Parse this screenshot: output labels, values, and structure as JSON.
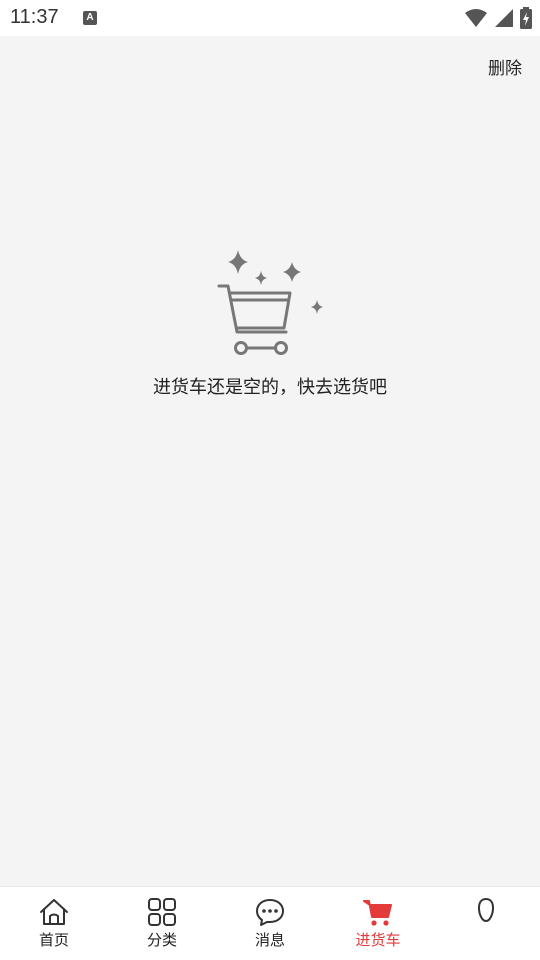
{
  "status_bar": {
    "time": "11:37",
    "icons": [
      "a-notification-icon",
      "wifi-icon",
      "signal-icon",
      "battery-charging-icon"
    ]
  },
  "header": {
    "delete_label": "删除"
  },
  "empty_state": {
    "illustration": "empty-cart-sparkles-icon",
    "message": "进货车还是空的，快去选货吧"
  },
  "tab_bar": {
    "active_color": "#e33a3a",
    "tabs": [
      {
        "label": "首页",
        "icon": "home-icon",
        "active": false
      },
      {
        "label": "分类",
        "icon": "grid-icon",
        "active": false
      },
      {
        "label": "消息",
        "icon": "chat-bubble-icon",
        "active": false
      },
      {
        "label": "进货车",
        "icon": "cart-icon",
        "active": true
      },
      {
        "label": "",
        "icon": "profile-icon",
        "active": false
      }
    ]
  }
}
